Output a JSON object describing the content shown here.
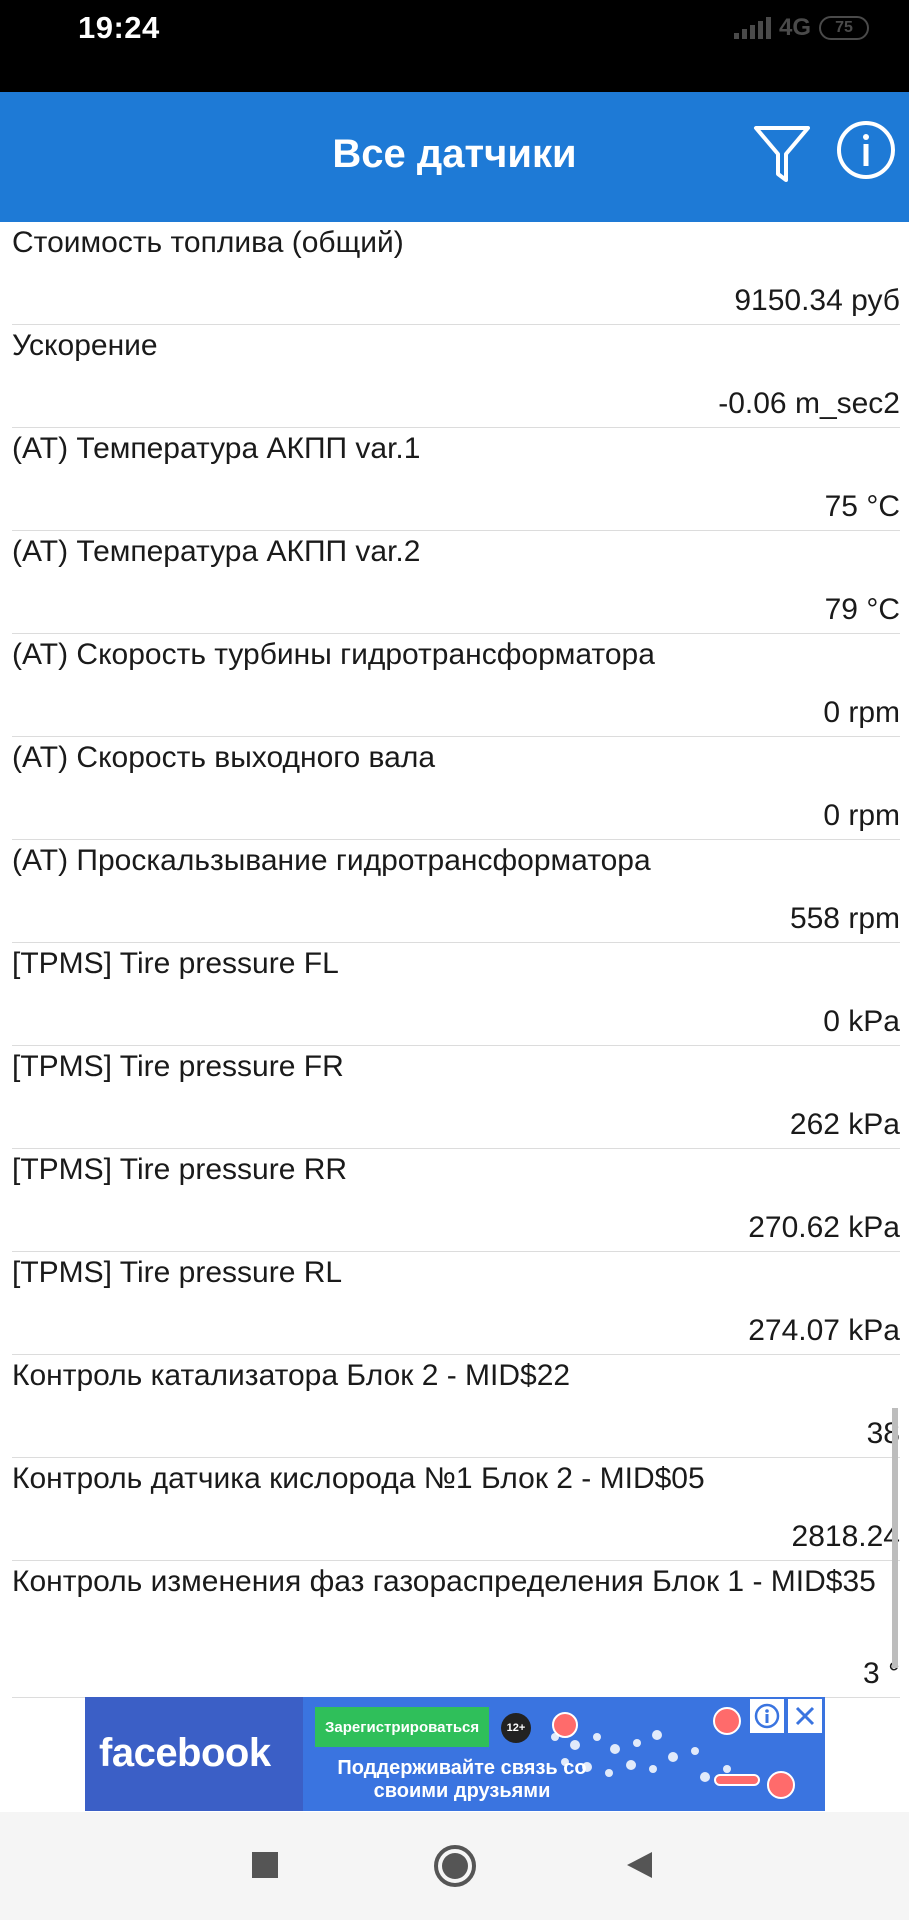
{
  "status_bar": {
    "time": "19:24",
    "network": "4G",
    "battery": "75"
  },
  "app_bar": {
    "title": "Все датчики",
    "icons": [
      "filter-icon",
      "info-icon"
    ]
  },
  "sensors": [
    {
      "name": "Стоимость топлива (общий)",
      "value": "9150.34 руб"
    },
    {
      "name": "Ускорение",
      "value": "-0.06 m_sec2"
    },
    {
      "name": "(AT) Температура АКПП var.1",
      "value": "75 °C"
    },
    {
      "name": "(AT) Температура АКПП var.2",
      "value": "79 °C"
    },
    {
      "name": "(AT) Скорость турбины гидротрансформатора",
      "value": "0 rpm"
    },
    {
      "name": "(AT) Скорость выходного вала",
      "value": "0 rpm"
    },
    {
      "name": "(AT) Проскальзывание гидротрансформатора",
      "value": "558 rpm"
    },
    {
      "name": "[TPMS] Tire pressure FL",
      "value": "0 kPa"
    },
    {
      "name": "[TPMS] Tire pressure FR",
      "value": "262 kPa"
    },
    {
      "name": "[TPMS] Tire pressure RR",
      "value": "270.62 kPa"
    },
    {
      "name": "[TPMS] Tire pressure RL",
      "value": "274.07 kPa"
    },
    {
      "name": "Контроль катализатора Блок 2 - MID$22",
      "value": "38"
    },
    {
      "name": "Контроль датчика кислорода №1 Блок 2 - MID$05",
      "value": "2818.24"
    },
    {
      "name": "Контроль изменения фаз газораспределения Блок 1 - MID$35",
      "value": "3 °"
    }
  ],
  "ad": {
    "brand": "facebook",
    "cta": "Зарегистрироваться",
    "age": "12+",
    "text": "Поддерживайте связь со своими друзьями",
    "colors": {
      "brand_bg": "#3b5fc6",
      "cta": "#2fbf5a"
    }
  },
  "nav_bar": {
    "icons": [
      "recents-icon",
      "home-icon",
      "back-icon"
    ]
  },
  "colors": {
    "app_bar": "#1e7ad6",
    "status_bar": "#000000"
  }
}
